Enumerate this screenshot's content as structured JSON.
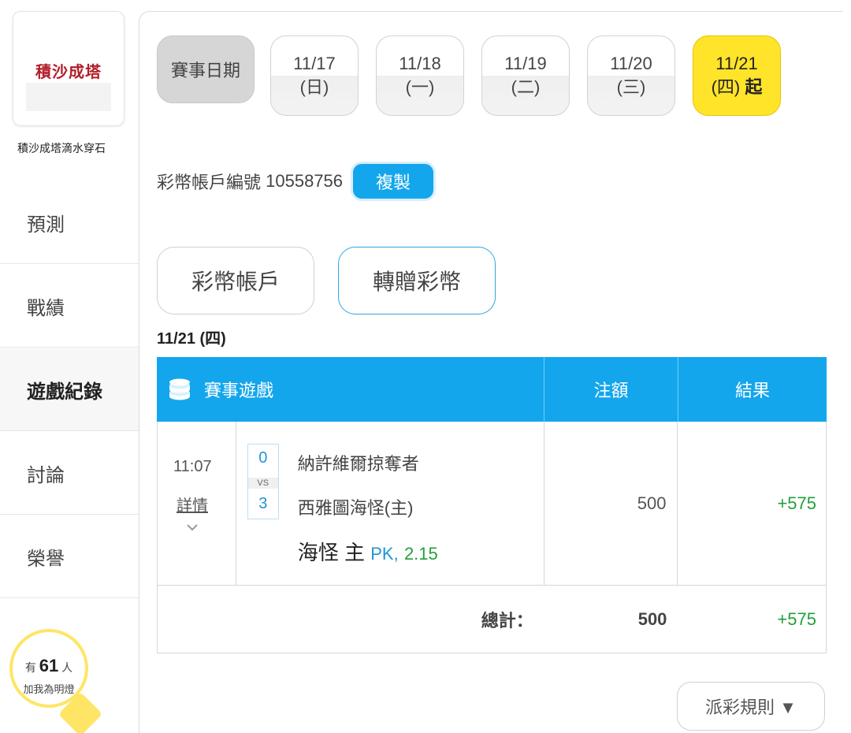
{
  "sidebar": {
    "avatar_logo_text": "積沙成塔",
    "username": "積沙成塔滴水穿石",
    "items": [
      {
        "label": "預測"
      },
      {
        "label": "戰績"
      },
      {
        "label": "遊戲紀錄"
      },
      {
        "label": "討論"
      },
      {
        "label": "榮譽"
      }
    ],
    "fans": {
      "prefix": "有",
      "count": "61",
      "suffix": "人",
      "caption": "加我為明燈"
    }
  },
  "dates": {
    "label": "賽事日期",
    "chips": [
      {
        "date": "11/17",
        "day": "(日)"
      },
      {
        "date": "11/18",
        "day": "(一)"
      },
      {
        "date": "11/19",
        "day": "(二)"
      },
      {
        "date": "11/20",
        "day": "(三)"
      },
      {
        "date": "11/21",
        "day": "(四)",
        "suffix": "起"
      }
    ]
  },
  "account": {
    "label": "彩幣帳戶編號",
    "number": "10558756",
    "copy_label": "複製"
  },
  "tabs": [
    {
      "label": "彩幣帳戶"
    },
    {
      "label": "轉贈彩幣"
    }
  ],
  "day_title": "11/21 (四)",
  "table": {
    "headers": {
      "game": "賽事遊戲",
      "amount": "注額",
      "result": "結果"
    },
    "rows": [
      {
        "time": "11:07",
        "detail": "詳情",
        "score_away": "0",
        "vs": "VS",
        "score_home": "3",
        "team_away": "納許維爾掠奪者",
        "team_home": "西雅圖海怪(主)",
        "pick": "海怪 主",
        "pick_type": "PK,",
        "odds": "2.15",
        "amount": "500",
        "result": "+575"
      }
    ],
    "total_label": "總計：",
    "total_amount": "500",
    "total_result": "+575"
  },
  "rules_label": "派彩規則 ▼",
  "colors": {
    "accent": "#14a6ec",
    "highlight": "#ffe42a",
    "win": "#22a03a"
  }
}
